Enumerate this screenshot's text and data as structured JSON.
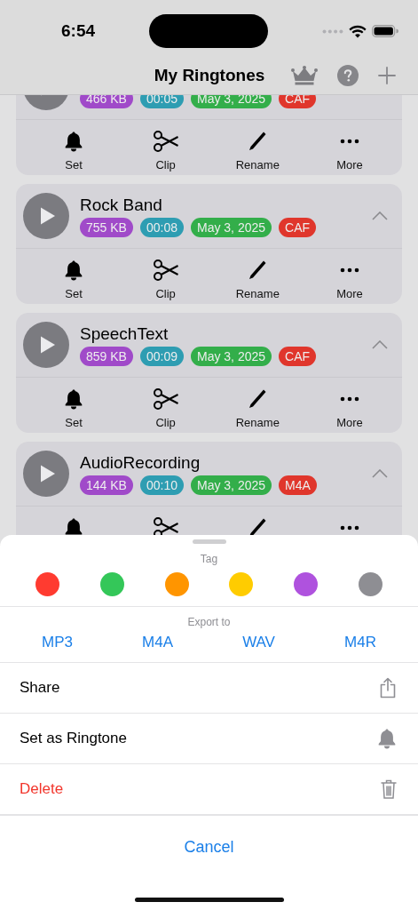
{
  "status_bar": {
    "time": "6:54"
  },
  "nav": {
    "title": "My Ringtones"
  },
  "ringtones": [
    {
      "badges": [
        {
          "text": "466 KB",
          "color": "#a04ac9"
        },
        {
          "text": "00:05",
          "color": "#2e9db2"
        },
        {
          "text": "May 3, 2025",
          "color": "#33ae4a"
        },
        {
          "text": "CAF",
          "color": "#e0362c"
        }
      ],
      "actions": [
        {
          "label": "Set",
          "kind": "bell"
        },
        {
          "label": "Clip",
          "kind": "scissors"
        },
        {
          "label": "Rename",
          "kind": "pencil"
        },
        {
          "label": "More",
          "kind": "more"
        }
      ]
    },
    {
      "name": "Rock Band",
      "expanded": true,
      "badges": [
        {
          "text": "755 KB",
          "color": "#a04ac9"
        },
        {
          "text": "00:08",
          "color": "#2e9db2"
        },
        {
          "text": "May 3, 2025",
          "color": "#33ae4a"
        },
        {
          "text": "CAF",
          "color": "#e0362c"
        }
      ],
      "actions": [
        {
          "label": "Set",
          "kind": "bell"
        },
        {
          "label": "Clip",
          "kind": "scissors"
        },
        {
          "label": "Rename",
          "kind": "pencil"
        },
        {
          "label": "More",
          "kind": "more"
        }
      ]
    },
    {
      "name": "SpeechText",
      "expanded": true,
      "badges": [
        {
          "text": "859 KB",
          "color": "#a04ac9"
        },
        {
          "text": "00:09",
          "color": "#2e9db2"
        },
        {
          "text": "May 3, 2025",
          "color": "#33ae4a"
        },
        {
          "text": "CAF",
          "color": "#e0362c"
        }
      ],
      "actions": [
        {
          "label": "Set",
          "kind": "bell"
        },
        {
          "label": "Clip",
          "kind": "scissors"
        },
        {
          "label": "Rename",
          "kind": "pencil"
        },
        {
          "label": "More",
          "kind": "more"
        }
      ]
    },
    {
      "name": "AudioRecording",
      "expanded": true,
      "badges": [
        {
          "text": "144 KB",
          "color": "#a04ac9"
        },
        {
          "text": "00:10",
          "color": "#2e9db2"
        },
        {
          "text": "May 3, 2025",
          "color": "#33ae4a"
        },
        {
          "text": "M4A",
          "color": "#e0362c"
        }
      ],
      "actions": [
        {
          "kind": "bell"
        },
        {
          "kind": "scissors"
        },
        {
          "kind": "pencil"
        },
        {
          "kind": "more"
        }
      ]
    }
  ],
  "sheet": {
    "tag_label": "Tag",
    "tags": [
      {
        "color": "#ff3b30"
      },
      {
        "color": "#34c759"
      },
      {
        "color": "#ff9500"
      },
      {
        "color": "#ffcc00"
      },
      {
        "color": "#af52de"
      },
      {
        "color": "#8e8e93"
      }
    ],
    "export_label": "Export to",
    "formats": [
      "MP3",
      "M4A",
      "WAV",
      "M4R"
    ],
    "rows": [
      {
        "label": "Share",
        "kind": "share",
        "destructive": false
      },
      {
        "label": "Set as Ringtone",
        "kind": "bell",
        "destructive": false
      },
      {
        "label": "Delete",
        "kind": "trash",
        "destructive": true
      }
    ],
    "cancel": "Cancel"
  }
}
